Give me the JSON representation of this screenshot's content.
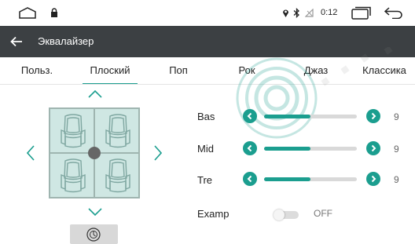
{
  "status_bar": {
    "time": "0:12",
    "icons": [
      "home-icon",
      "lock-icon",
      "location-icon",
      "bluetooth-icon",
      "no-signal-icon",
      "recent-apps-icon",
      "back-icon"
    ]
  },
  "header": {
    "title": "Эквалайзер",
    "back_icon": "arrow-left-icon"
  },
  "tabs": [
    {
      "label": "Польз.",
      "active": false
    },
    {
      "label": "Плоский",
      "active": true
    },
    {
      "label": "Поп",
      "active": false
    },
    {
      "label": "Рок",
      "active": false
    },
    {
      "label": "Джаз",
      "active": false
    },
    {
      "label": "Классика",
      "active": false
    }
  ],
  "balance": {
    "icons": [
      "chevron-up-icon",
      "chevron-down-icon",
      "chevron-left-icon",
      "chevron-right-icon",
      "reset-icon"
    ]
  },
  "eq": [
    {
      "label": "Bas",
      "value": "9",
      "fill": 0.5
    },
    {
      "label": "Mid",
      "value": "9",
      "fill": 0.5
    },
    {
      "label": "Tre",
      "value": "9",
      "fill": 0.5
    }
  ],
  "loudness": {
    "label": "Examp",
    "state": "OFF"
  },
  "colors": {
    "accent": "#1b9e8f",
    "titlebar": "#3c4043",
    "seat_bg": "#cfe7e3"
  }
}
